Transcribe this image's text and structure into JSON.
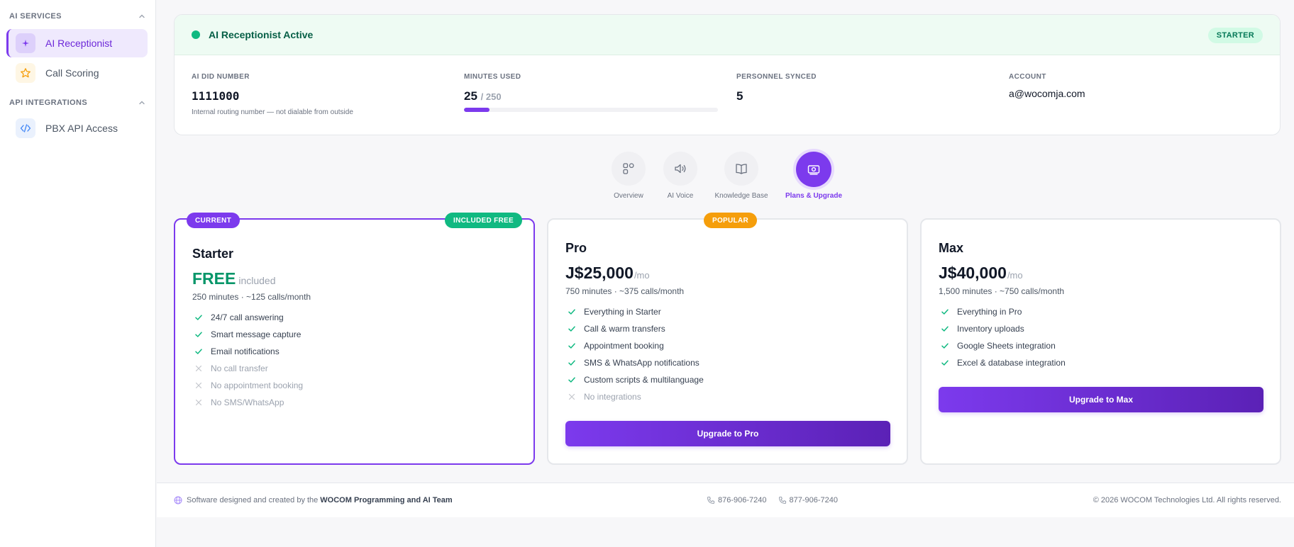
{
  "sidebar": {
    "sections": [
      {
        "title": "AI SERVICES",
        "items": [
          {
            "label": "AI Receptionist",
            "icon": "sparkle-icon",
            "active": true
          },
          {
            "label": "Call Scoring",
            "icon": "star-icon",
            "active": false
          }
        ]
      },
      {
        "title": "API INTEGRATIONS",
        "items": [
          {
            "label": "PBX API Access",
            "icon": "code-icon",
            "active": false
          }
        ]
      }
    ]
  },
  "status": {
    "title": "AI Receptionist Active",
    "tier": "STARTER",
    "stats": {
      "did": {
        "label": "AI DID NUMBER",
        "value": "1111000",
        "note": "Internal routing number — not dialable from outside"
      },
      "minutes": {
        "label": "MINUTES USED",
        "value": "25",
        "total": "/ 250",
        "fraction": 0.1
      },
      "personnel": {
        "label": "PERSONNEL SYNCED",
        "value": "5"
      },
      "account": {
        "label": "ACCOUNT",
        "value": "a@wocomja.com"
      }
    }
  },
  "tabs": [
    {
      "label": "Overview",
      "icon": "grid-icon",
      "active": false
    },
    {
      "label": "AI Voice",
      "icon": "speaker-icon",
      "active": false
    },
    {
      "label": "Knowledge Base",
      "icon": "book-icon",
      "active": false
    },
    {
      "label": "Plans & Upgrade",
      "icon": "money-icon",
      "active": true
    }
  ],
  "plans": {
    "starter": {
      "ribbon": "CURRENT",
      "extra_ribbon": "INCLUDED FREE",
      "name": "Starter",
      "price": "FREE",
      "price_suffix": "included",
      "quota": "250 minutes · ~125 calls/month",
      "features": [
        {
          "text": "24/7 call answering",
          "included": true
        },
        {
          "text": "Smart message capture",
          "included": true
        },
        {
          "text": "Email notifications",
          "included": true
        },
        {
          "text": "No call transfer",
          "included": false
        },
        {
          "text": "No appointment booking",
          "included": false
        },
        {
          "text": "No SMS/WhatsApp",
          "included": false
        }
      ]
    },
    "pro": {
      "ribbon": "POPULAR",
      "name": "Pro",
      "price": "J$25,000",
      "price_suffix": "/mo",
      "quota": "750 minutes · ~375 calls/month",
      "features": [
        {
          "text": "Everything in Starter",
          "included": true
        },
        {
          "text": "Call & warm transfers",
          "included": true
        },
        {
          "text": "Appointment booking",
          "included": true
        },
        {
          "text": "SMS & WhatsApp notifications",
          "included": true
        },
        {
          "text": "Custom scripts & multilanguage",
          "included": true
        },
        {
          "text": "No integrations",
          "included": false
        }
      ],
      "button": "Upgrade to Pro"
    },
    "max": {
      "name": "Max",
      "price": "J$40,000",
      "price_suffix": "/mo",
      "quota": "1,500 minutes · ~750 calls/month",
      "features": [
        {
          "text": "Everything in Pro",
          "included": true
        },
        {
          "text": "Inventory uploads",
          "included": true
        },
        {
          "text": "Google Sheets integration",
          "included": true
        },
        {
          "text": "Excel & database integration",
          "included": true
        }
      ],
      "button": "Upgrade to Max"
    }
  },
  "footer": {
    "credit_prefix": "Software designed and created by the",
    "credit_team": "WOCOM Programming and AI Team",
    "phones": [
      "876-906-7240",
      "877-906-7240"
    ],
    "copyright": "© 2026 WOCOM Technologies Ltd. All rights reserved."
  },
  "colors": {
    "accent": "#7c3aed",
    "success": "#10b981",
    "popular": "#f59e0b"
  }
}
